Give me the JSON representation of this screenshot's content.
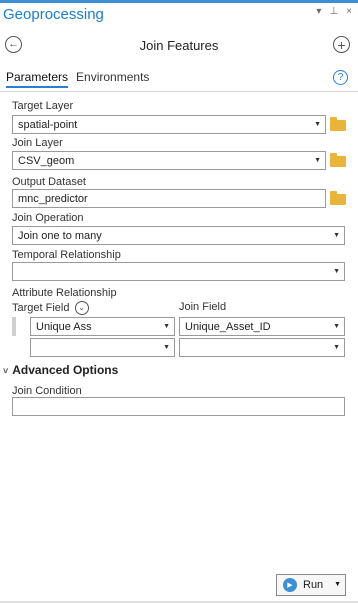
{
  "window": {
    "title": "Geoprocessing",
    "controls": {
      "menu": "▾",
      "pin": "⊥",
      "close": "×"
    }
  },
  "header": {
    "title": "Join Features"
  },
  "tabs": [
    {
      "label": "Parameters"
    },
    {
      "label": "Environments"
    }
  ],
  "help_icon": "?",
  "params": {
    "target_layer": {
      "label": "Target Layer",
      "value": "spatial-point"
    },
    "join_layer": {
      "label": "Join Layer",
      "value": "CSV_geom"
    },
    "output_dataset": {
      "label": "Output Dataset",
      "value": "mnc_predictor"
    },
    "join_operation": {
      "label": "Join Operation",
      "value": "Join one to many"
    },
    "temporal_relationship": {
      "label": "Temporal Relationship",
      "value": ""
    }
  },
  "attribute_relationship": {
    "label": "Attribute Relationship",
    "target_field_label": "Target Field",
    "join_field_label": "Join Field",
    "rows": [
      {
        "target": "Unique Ass",
        "join": "Unique_Asset_ID"
      },
      {
        "target": "",
        "join": ""
      }
    ]
  },
  "advanced": {
    "label": "Advanced Options",
    "join_condition_label": "Join Condition",
    "join_condition_value": ""
  },
  "run_button": {
    "label": "Run"
  }
}
